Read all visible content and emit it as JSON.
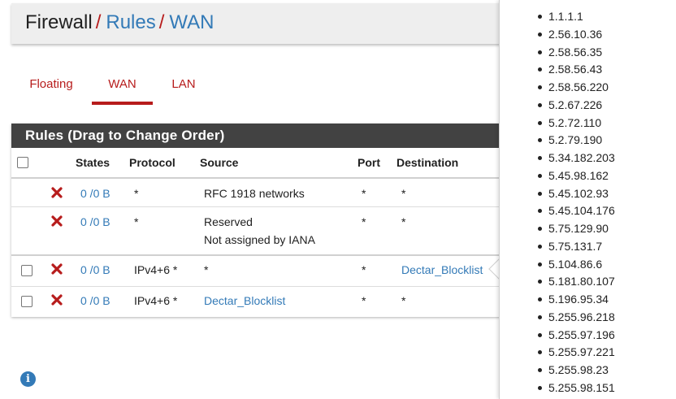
{
  "breadcrumb": {
    "firewall": "Firewall",
    "rules": "Rules",
    "wan": "WAN",
    "separator": "/"
  },
  "tabs": [
    {
      "label": "Floating",
      "active": false
    },
    {
      "label": "WAN",
      "active": true
    },
    {
      "label": "LAN",
      "active": false
    }
  ],
  "panel": {
    "heading": "Rules (Drag to Change Order)",
    "columns": {
      "states": "States",
      "protocol": "Protocol",
      "source": "Source",
      "port": "Port",
      "destination": "Destination"
    },
    "rows": [
      {
        "states": "0 /0 B",
        "protocol": "*",
        "source": "RFC 1918 networks",
        "port": "*",
        "destination": "*",
        "has_checkbox": false
      },
      {
        "states": "0 /0 B",
        "protocol": "*",
        "source": "Reserved",
        "source_line2": "Not assigned by IANA",
        "port": "*",
        "destination": "*",
        "has_checkbox": false
      },
      {
        "states": "0 /0 B",
        "protocol": "IPv4+6 *",
        "source": "*",
        "port": "*",
        "destination": "Dectar_Blocklist",
        "has_checkbox": true
      },
      {
        "states": "0 /0 B",
        "protocol": "IPv4+6 *",
        "source": "Dectar_Blocklist",
        "port": "*",
        "destination": "*",
        "has_checkbox": true
      }
    ]
  },
  "popup": {
    "items": [
      "1.1.1.1",
      "2.56.10.36",
      "2.58.56.35",
      "2.58.56.43",
      "2.58.56.220",
      "5.2.67.226",
      "5.2.72.110",
      "5.2.79.190",
      "5.34.182.203",
      "5.45.98.162",
      "5.45.102.93",
      "5.45.104.176",
      "5.75.129.90",
      "5.75.131.7",
      "5.104.86.6",
      "5.181.80.107",
      "5.196.95.34",
      "5.255.96.218",
      "5.255.97.196",
      "5.255.97.221",
      "5.255.98.23",
      "5.255.98.151"
    ]
  },
  "colors": {
    "accent_red": "#b71c1c",
    "link_blue": "#337ab7",
    "panel_heading": "#424242"
  },
  "icons": {
    "delete": "x-icon",
    "info": "info-icon"
  }
}
